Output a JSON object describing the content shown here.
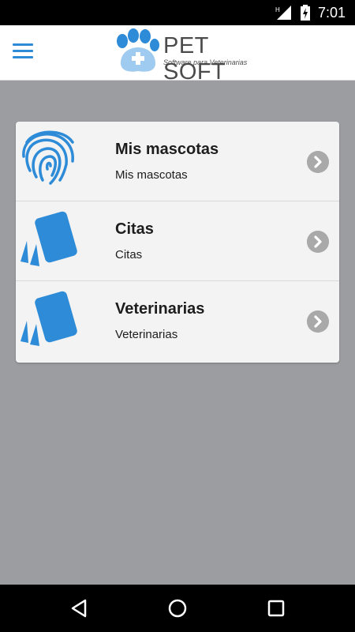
{
  "status_bar": {
    "time": "7:01",
    "icons": [
      "signal-icon",
      "battery-charging-icon"
    ]
  },
  "app_bar": {
    "menu_icon": "hamburger-menu-icon",
    "logo": {
      "title": "PET SOFT",
      "subtitle": "Software para Veterinarias",
      "icon": "paw-cross-icon"
    }
  },
  "menu_items": [
    {
      "title": "Mis mascotas",
      "subtitle": "Mis mascotas",
      "icon": "fingerprint-icon"
    },
    {
      "title": "Citas",
      "subtitle": "Citas",
      "icon": "cards-icon"
    },
    {
      "title": "Veterinarias",
      "subtitle": "Veterinarias",
      "icon": "cards-icon"
    }
  ],
  "nav_bar": {
    "buttons": [
      "back-icon",
      "home-icon",
      "recents-icon"
    ]
  },
  "colors": {
    "accent": "#2d8bd7",
    "background": "#9c9da1",
    "card": "#f3f3f3",
    "chevron": "#a9a9a9"
  }
}
